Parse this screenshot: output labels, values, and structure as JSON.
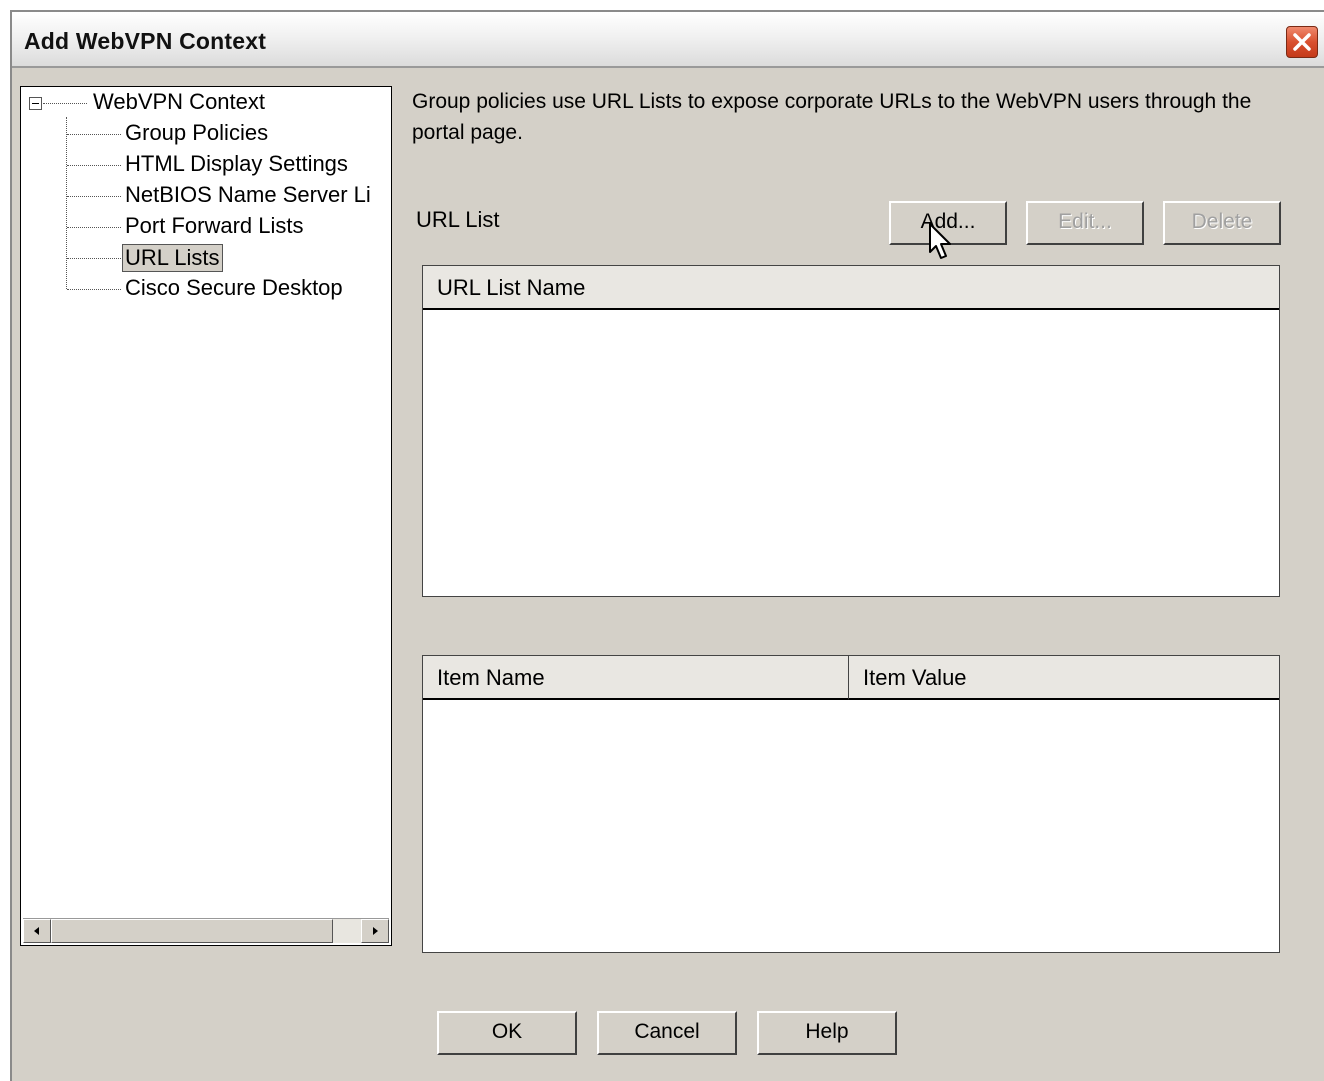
{
  "window": {
    "title": "Add WebVPN Context"
  },
  "tree": {
    "root": "WebVPN Context",
    "items": [
      {
        "label": "Group Policies",
        "selected": false
      },
      {
        "label": "HTML Display Settings",
        "selected": false
      },
      {
        "label": "NetBIOS Name Server Li",
        "selected": false
      },
      {
        "label": "Port Forward Lists",
        "selected": false
      },
      {
        "label": "URL Lists",
        "selected": true
      },
      {
        "label": "Cisco Secure Desktop",
        "selected": false
      }
    ]
  },
  "description": "Group policies use URL Lists to expose corporate URLs to the WebVPN users through the portal page.",
  "url_list": {
    "label": "URL List",
    "buttons": {
      "add": "Add...",
      "edit": "Edit...",
      "delete": "Delete"
    },
    "table_header": "URL List Name",
    "rows": []
  },
  "items_table": {
    "headers": [
      "Item Name",
      "Item Value"
    ],
    "rows": []
  },
  "footer": {
    "ok": "OK",
    "cancel": "Cancel",
    "help": "Help"
  },
  "icons": {
    "close": "close-icon",
    "collapse": "tree-collapse-icon",
    "scroll_left": "scroll-left-icon",
    "scroll_right": "scroll-right-icon",
    "cursor": "mouse-pointer-icon"
  }
}
